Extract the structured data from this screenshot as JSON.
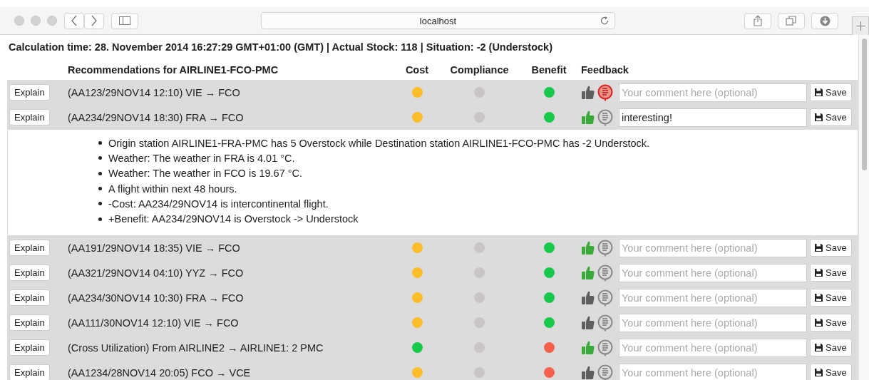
{
  "browser": {
    "address": "localhost"
  },
  "summary": "Calculation time: 28. November 2014 16:27:29 GMT+01:00 (GMT) | Actual Stock: 118 | Situation: -2 (Understock)",
  "table": {
    "columns": [
      "Recommendations for AIRLINE1-FCO-PMC",
      "Cost",
      "Compliance",
      "Benefit",
      "Feedback"
    ],
    "rows": [
      {
        "button": "Explain",
        "label": "(AA123/29NOV14 12:10) VIE → FCO",
        "cost": {
          "color": "#fbbd2a"
        },
        "compliance": {
          "color": "#c9c5c7"
        },
        "benefit": {
          "color": "#17c94a"
        },
        "thumbs_up": {
          "selected": false
        },
        "thumbs_down": {
          "selected": true
        },
        "comment": {
          "placeholder": "Your comment here (optional)"
        },
        "save": "Save",
        "expanded": false
      },
      {
        "button": "Explain",
        "label": "(AA234/29NOV14 18:30) FRA → FCO",
        "cost": {
          "color": "#fbbd2a"
        },
        "compliance": {
          "color": "#c9c5c7"
        },
        "benefit": {
          "color": "#17c94a"
        },
        "thumbs_up": {
          "selected": true
        },
        "thumbs_down": {
          "selected": false
        },
        "comment": {
          "value": "interesting!"
        },
        "save": "Save",
        "expanded": true,
        "explanation": [
          "Origin station AIRLINE1-FRA-PMC has 5 Overstock while Destination station AIRLINE1-FCO-PMC has -2 Understock.",
          "Weather: The weather in FRA is 4.01 °C.",
          "Weather: The weather in FCO is 19.67 °C.",
          "A flight within next 48 hours.",
          "-Cost: AA234/29NOV14 is intercontinental flight.",
          "+Benefit: AA234/29NOV14 is Overstock -> Understock"
        ]
      },
      {
        "button": "Explain",
        "label": "(AA191/29NOV14 18:35) VIE → FCO",
        "cost": {
          "color": "#fbbd2a"
        },
        "compliance": {
          "color": "#c9c5c7"
        },
        "benefit": {
          "color": "#17c94a"
        },
        "thumbs_up": {
          "selected": true
        },
        "thumbs_down": {
          "selected": false
        },
        "comment": {
          "placeholder": "Your comment here (optional)"
        },
        "save": "Save",
        "expanded": false
      },
      {
        "button": "Explain",
        "label": "(AA321/29NOV14 04:10) YYZ → FCO",
        "cost": {
          "color": "#fbbd2a"
        },
        "compliance": {
          "color": "#c9c5c7"
        },
        "benefit": {
          "color": "#17c94a"
        },
        "thumbs_up": {
          "selected": true
        },
        "thumbs_down": {
          "selected": false
        },
        "comment": {
          "placeholder": "Your comment here (optional)"
        },
        "save": "Save",
        "expanded": false
      },
      {
        "button": "Explain",
        "label": "(AA234/30NOV14 10:30) FRA → FCO",
        "cost": {
          "color": "#fbbd2a"
        },
        "compliance": {
          "color": "#c9c5c7"
        },
        "benefit": {
          "color": "#17c94a"
        },
        "thumbs_up": {
          "selected": false
        },
        "thumbs_down": {
          "selected": false
        },
        "comment": {
          "placeholder": "Your comment here (optional)"
        },
        "save": "Save",
        "expanded": false
      },
      {
        "button": "Explain",
        "label": "(AA111/30NOV14 12:10) VIE → FCO",
        "cost": {
          "color": "#fbbd2a"
        },
        "compliance": {
          "color": "#c9c5c7"
        },
        "benefit": {
          "color": "#17c94a"
        },
        "thumbs_up": {
          "selected": false
        },
        "thumbs_down": {
          "selected": false
        },
        "comment": {
          "placeholder": "Your comment here (optional)"
        },
        "save": "Save",
        "expanded": false
      },
      {
        "button": "Explain",
        "label": "(Cross Utilization) From AIRLINE2 → AIRLINE1: 2 PMC",
        "cost": {
          "color": "#17c94a"
        },
        "compliance": {
          "color": "#c9c5c7"
        },
        "benefit": {
          "color": "#f5604e"
        },
        "thumbs_up": {
          "selected": true
        },
        "thumbs_down": {
          "selected": false
        },
        "comment": {
          "placeholder": "Your comment here (optional)"
        },
        "save": "Save",
        "expanded": false
      },
      {
        "button": "Explain",
        "label": "(AA1234/28NOV14 20:05) FCO → VCE",
        "cost": {
          "color": "#fbbd2a"
        },
        "compliance": {
          "color": "#c9c5c7"
        },
        "benefit": {
          "color": "#f5604e"
        },
        "thumbs_up": {
          "selected": false
        },
        "thumbs_down": {
          "selected": false
        },
        "comment": {
          "placeholder": "Your comment here (optional)"
        },
        "save": "Save",
        "expanded": false
      }
    ]
  }
}
